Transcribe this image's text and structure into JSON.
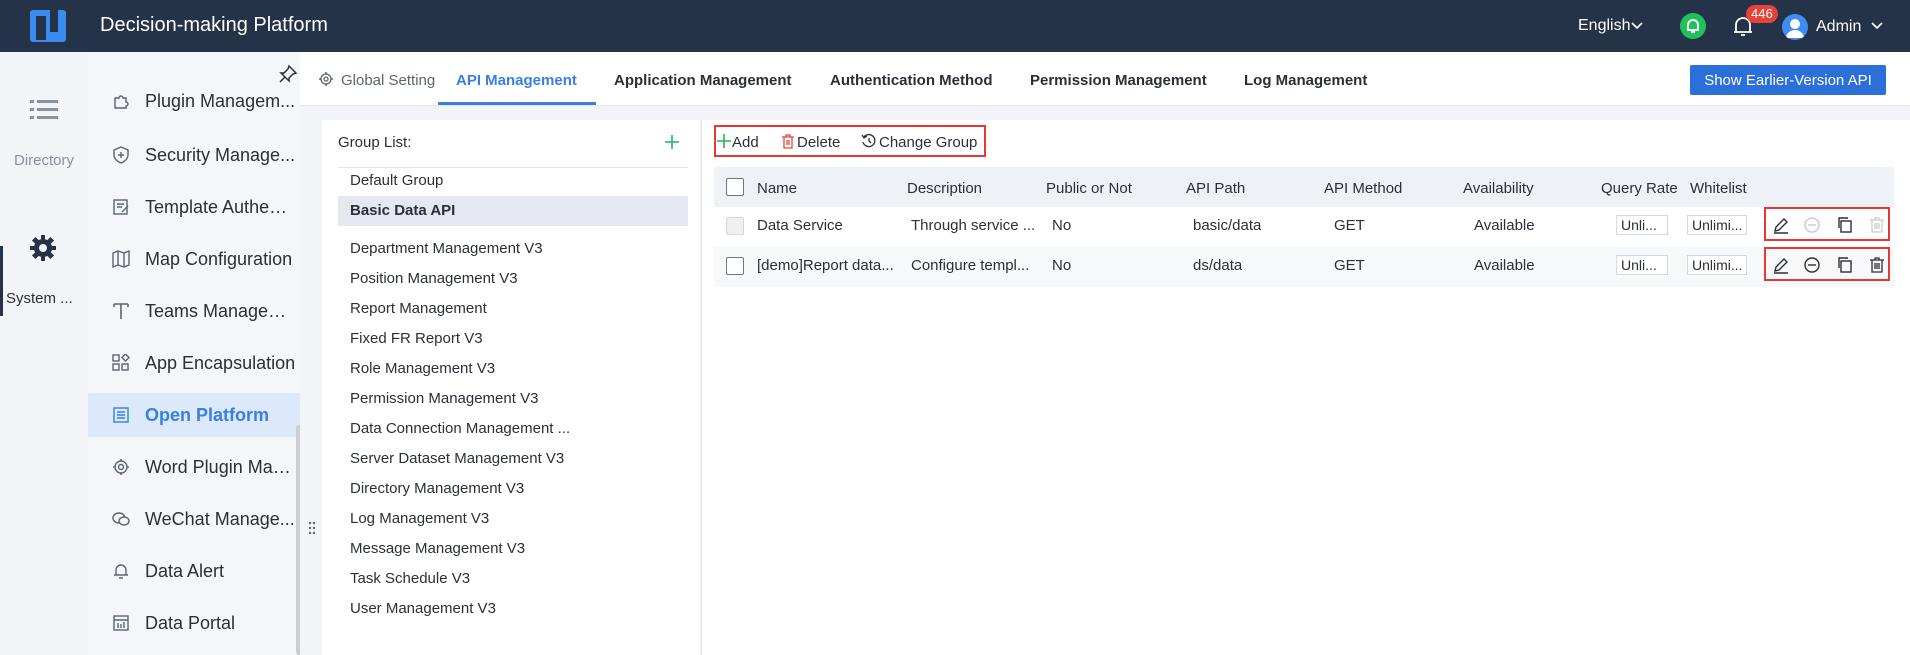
{
  "header": {
    "app_title": "Decision-making Platform",
    "language": "English",
    "notification_count": "446",
    "user": "Admin"
  },
  "rail": {
    "directory_label": "Directory",
    "system_label": "System ..."
  },
  "submenu": {
    "items": [
      {
        "label": "Plugin Managem...",
        "icon": "puzzle-icon"
      },
      {
        "label": "Security Manage...",
        "icon": "shield-icon"
      },
      {
        "label": "Template Authent...",
        "icon": "template-icon"
      },
      {
        "label": "Map Configuration",
        "icon": "map-icon"
      },
      {
        "label": "Teams Managem...",
        "icon": "teams-icon"
      },
      {
        "label": "App Encapsulation",
        "icon": "app-grid-icon"
      },
      {
        "label": "Open Platform",
        "icon": "list-doc-icon"
      },
      {
        "label": "Word Plugin Man...",
        "icon": "gear-icon"
      },
      {
        "label": "WeChat Manage...",
        "icon": "wechat-icon"
      },
      {
        "label": "Data Alert",
        "icon": "bell-icon"
      },
      {
        "label": "Data Portal",
        "icon": "portal-icon"
      }
    ]
  },
  "tabs": {
    "global": "Global Setting",
    "api": "API Management",
    "application": "Application Management",
    "authentication": "Authentication Method",
    "permission": "Permission Management",
    "log": "Log Management",
    "earlier_button": "Show Earlier-Version API"
  },
  "group_panel": {
    "title": "Group List:",
    "groups": [
      "Default Group",
      "Basic Data API"
    ],
    "apis": [
      "Department Management V3",
      "Position Management V3",
      "Report Management",
      "Fixed FR Report V3",
      "Role Management V3",
      "Permission Management V3",
      "Data Connection Management ...",
      "Server Dataset Management V3",
      "Directory Management V3",
      "Log Management V3",
      "Message Management V3",
      "Task Schedule V3",
      "User Management V3"
    ]
  },
  "toolbar": {
    "add": "Add",
    "delete": "Delete",
    "change_group": "Change Group"
  },
  "table": {
    "headers": {
      "name": "Name",
      "description": "Description",
      "public": "Public or Not",
      "path": "API Path",
      "method": "API Method",
      "availability": "Availability",
      "rate": "Query Rate",
      "whitelist": "Whitelist"
    },
    "rows": [
      {
        "name": "Data Service",
        "description": "Through service ...",
        "public": "No",
        "path": "basic/data",
        "method": "GET",
        "availability": "Available",
        "rate": "Unli...",
        "whitelist": "Unlimi..."
      },
      {
        "name": "[demo]Report data...",
        "description": "Configure templ...",
        "public": "No",
        "path": "ds/data",
        "method": "GET",
        "availability": "Available",
        "rate": "Unli...",
        "whitelist": "Unlimi..."
      }
    ]
  },
  "colors": {
    "topbar": "#253349",
    "accent": "#3b7ee2",
    "highlight_box": "#e53935",
    "add_green": "#1fb556",
    "delete_red": "#e5433a"
  }
}
